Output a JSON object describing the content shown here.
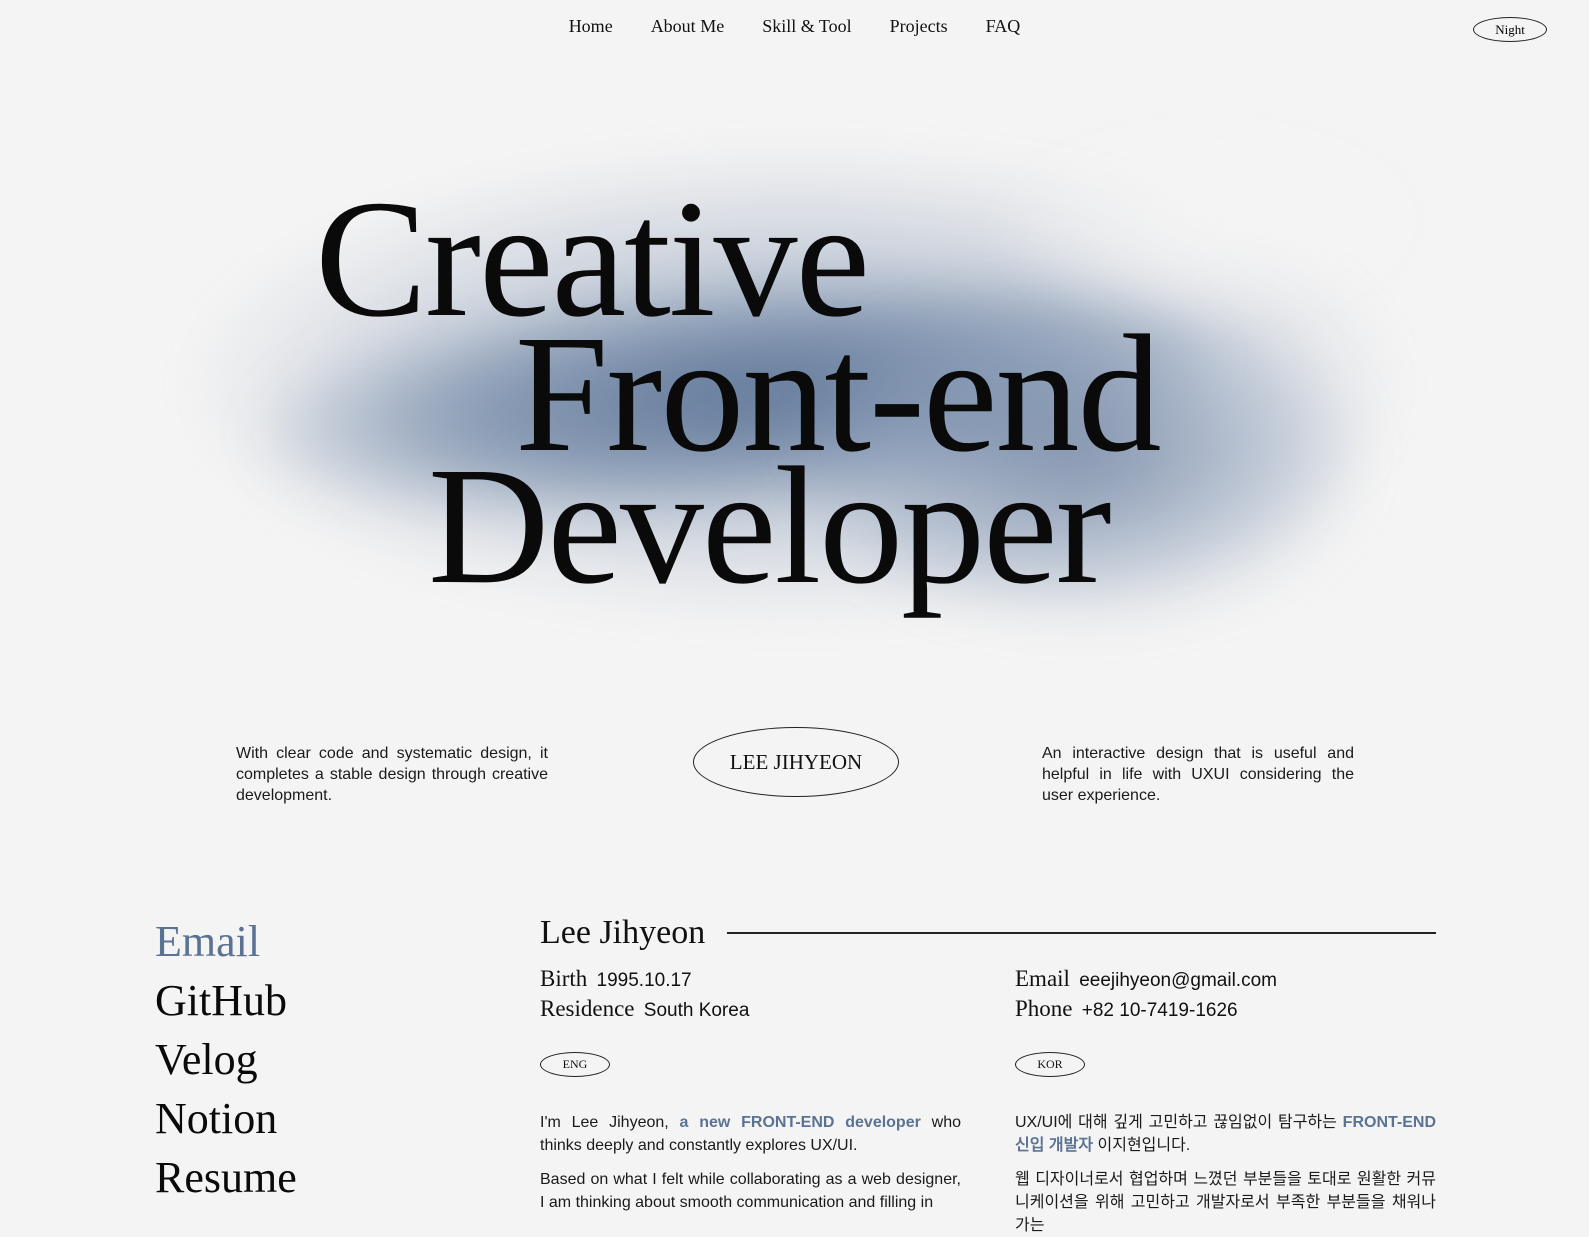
{
  "nav": {
    "items": [
      "Home",
      "About Me",
      "Skill & Tool",
      "Projects",
      "FAQ"
    ],
    "night_toggle": "Night"
  },
  "hero": {
    "line1": "Creative",
    "line2": "Front-end",
    "line3": "Developer"
  },
  "intro": {
    "left": "With clear code and systematic design, it completes a stable design through creative development.",
    "badge": "LEE JIHYEON",
    "right": "An interactive design that is useful and helpful in life with UXUI considering the user experience."
  },
  "links": [
    "Email",
    "GitHub",
    "Velog",
    "Notion",
    "Resume"
  ],
  "profile": {
    "name": "Lee Jihyeon",
    "birth_label": "Birth",
    "birth": "1995.10.17",
    "residence_label": "Residence",
    "residence": "South Korea",
    "email_label": "Email",
    "email": "eeejihyeon@gmail.com",
    "phone_label": "Phone",
    "phone": "+82 10-7419-1626"
  },
  "languages": {
    "eng_label": "ENG",
    "kor_label": "KOR"
  },
  "about_eng": {
    "p1_a": "I'm Lee Jihyeon,",
    "p1_hl": "a new FRONT-END developer",
    "p1_b": "who thinks deeply and constantly explores UX/UI.",
    "p2": "Based on what I felt while collaborating as a web designer, I am thinking about smooth communication and filling in"
  },
  "about_kor": {
    "p1_a": "UX/UI에 대해 깊게 고민하고 끊임없이 탐구하는",
    "p1_hl": "FRONT-END 신입 개발자",
    "p1_b": "이지현입니다.",
    "p2": "웹 디자이너로서 협업하며 느꼈던 부분들을 토대로 원활한 커뮤니케이션을 위해 고민하고 개발자로서 부족한 부분들을 채워나가는"
  },
  "colors": {
    "accent": "#5b7393",
    "background": "#f4f4f4",
    "text": "#111111"
  }
}
